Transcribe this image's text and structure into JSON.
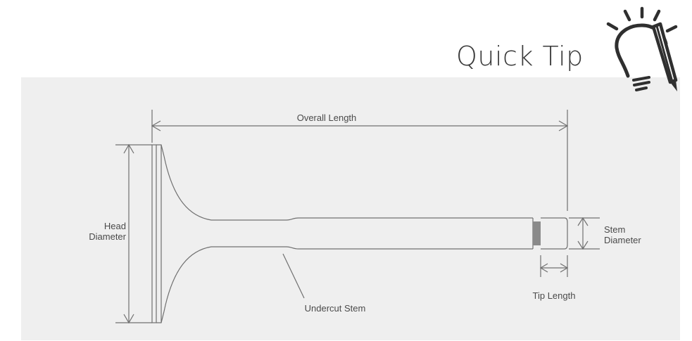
{
  "header": {
    "title": "Quick Tip"
  },
  "icons": {
    "tip": "lightbulb-pencil-icon"
  },
  "colors": {
    "panel": "#efefef",
    "line": "#707070",
    "text": "#4a4a4a",
    "tip_band": "#8a8a8a"
  },
  "labels": {
    "overall_length": "Overall Length",
    "head_diameter_line1": "Head",
    "head_diameter_line2": "Diameter",
    "stem_diameter_line1": "Stem",
    "stem_diameter_line2": "Diameter",
    "tip_length": "Tip Length",
    "undercut_stem": "Undercut Stem"
  }
}
